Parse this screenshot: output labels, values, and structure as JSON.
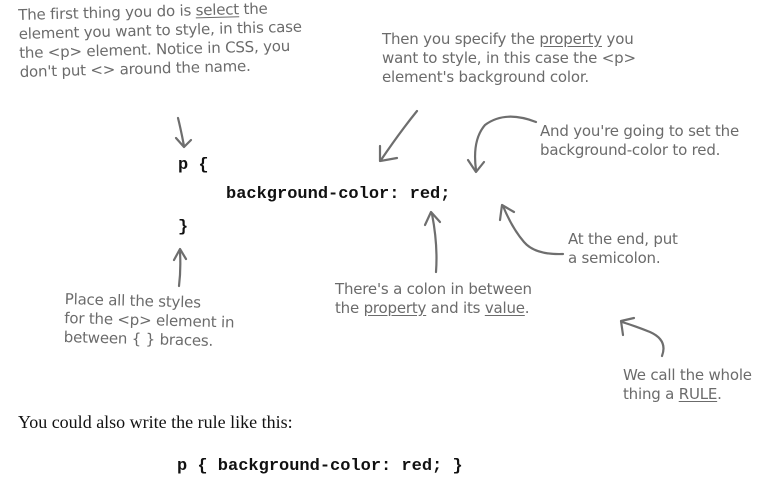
{
  "annotations": {
    "select": {
      "lines": [
        "The first thing you do is ",
        "select",
        " the",
        "element you want to style, in this case",
        "the <p> element. Notice in CSS, you",
        "don't put <> around the name."
      ]
    },
    "property": {
      "lines": [
        "Then you specify the ",
        "property",
        " you",
        "want to style, in this case the <p>",
        "element's background color."
      ]
    },
    "value": {
      "lines": [
        "And you're going to set the",
        "background-color to red."
      ]
    },
    "semicolon": {
      "lines": [
        "At the end, put",
        "a semicolon."
      ]
    },
    "colon": {
      "lines": [
        "There's a colon in between",
        "the ",
        "property",
        " and its ",
        "value",
        "."
      ]
    },
    "braces": {
      "lines": [
        "Place all the styles",
        "for the <p> element in",
        "between { } braces."
      ]
    },
    "rule": {
      "lines": [
        "We call the whole",
        "thing a ",
        "RULE",
        "."
      ]
    }
  },
  "code_block": {
    "line1": "p {",
    "line2": "background-color: red;",
    "line3": "}"
  },
  "prose": "You could also write the rule like this:",
  "code_oneline": "p { background-color: red; }"
}
